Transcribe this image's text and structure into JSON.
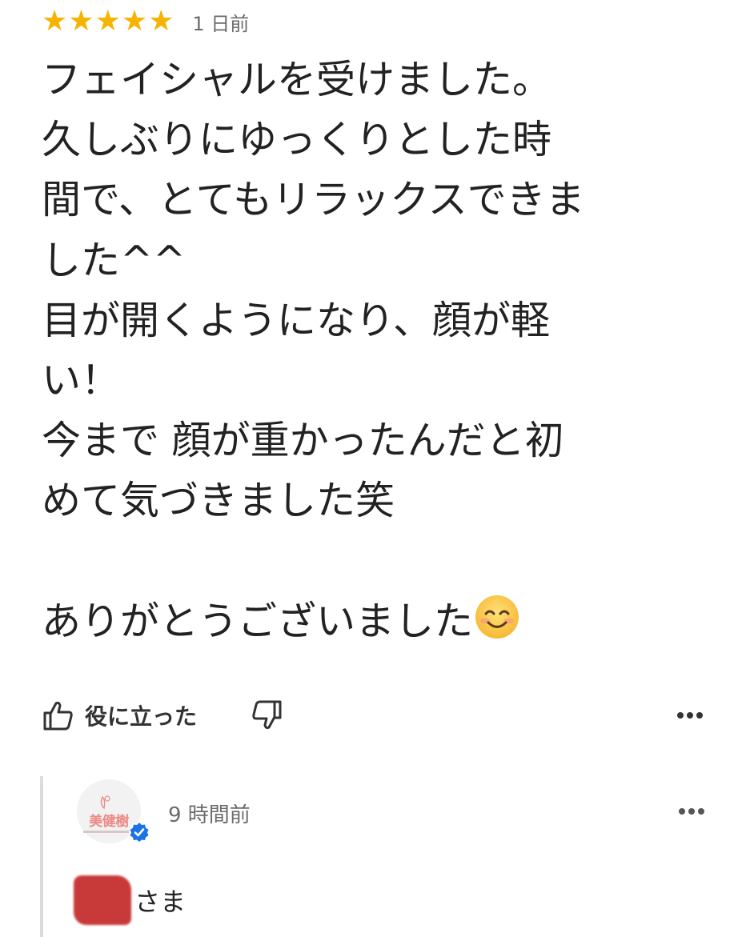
{
  "review": {
    "rating": 5,
    "stars": [
      "★",
      "★",
      "★",
      "★",
      "★"
    ],
    "time": "1 日前",
    "lines": [
      "フェイシャルを受けました。",
      "久しぶりにゆっくりとした時",
      "間で、とてもリラックスできま",
      "した^^",
      "目が開くようになり、顔が軽",
      "い！",
      "今まで 顔が重かったんだと初",
      "めて気づきました笑",
      "",
      "ありがとうございました"
    ],
    "emoji": "smiling-face-emoji"
  },
  "actions": {
    "helpful_label": "役に立った",
    "helpful_icon": "thumbs-up-icon",
    "unhelpful_icon": "thumbs-down-icon",
    "more_icon": "more-horizontal-icon"
  },
  "reply": {
    "owner_logo_text": "美健樹",
    "time": "9 時間前",
    "text": "さま",
    "verified_icon": "verified-check-icon",
    "more_icon": "more-horizontal-icon"
  },
  "colors": {
    "star": "#f4b400",
    "text": "#222222",
    "muted": "#6b6b6b",
    "verified": "#1a73e8",
    "brand": "#ec8a86",
    "redaction": "#c42a2a"
  }
}
